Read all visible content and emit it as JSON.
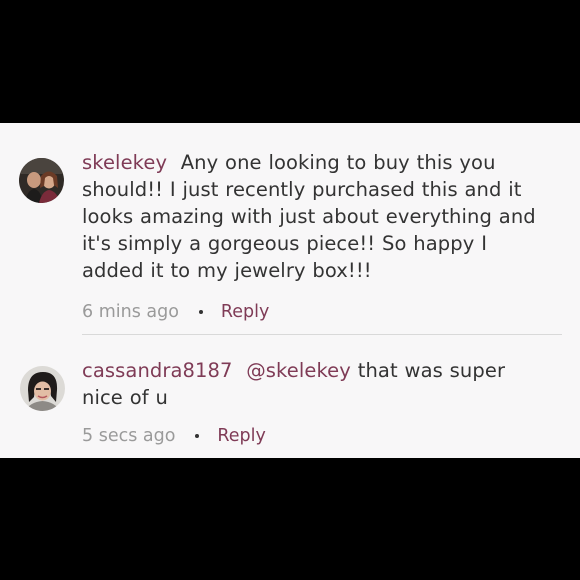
{
  "comments": [
    {
      "username": "skelekey",
      "text": "Any one looking to buy this you should!! I just recently purchased this and it looks amazing with just about everything and it's simply a gorgeous piece!! So happy I added it to my jewelry box!!!",
      "time": "6 mins ago",
      "reply_label": "Reply"
    },
    {
      "username": "cassandra8187",
      "mention": "@skelekey",
      "text": "that was super nice of u",
      "time": "5 secs ago",
      "reply_label": "Reply"
    }
  ],
  "colors": {
    "accent": "#7f3b56",
    "text": "#333333",
    "meta": "#9a9a9a",
    "panel": "#f8f7f8",
    "frame": "#000000"
  }
}
